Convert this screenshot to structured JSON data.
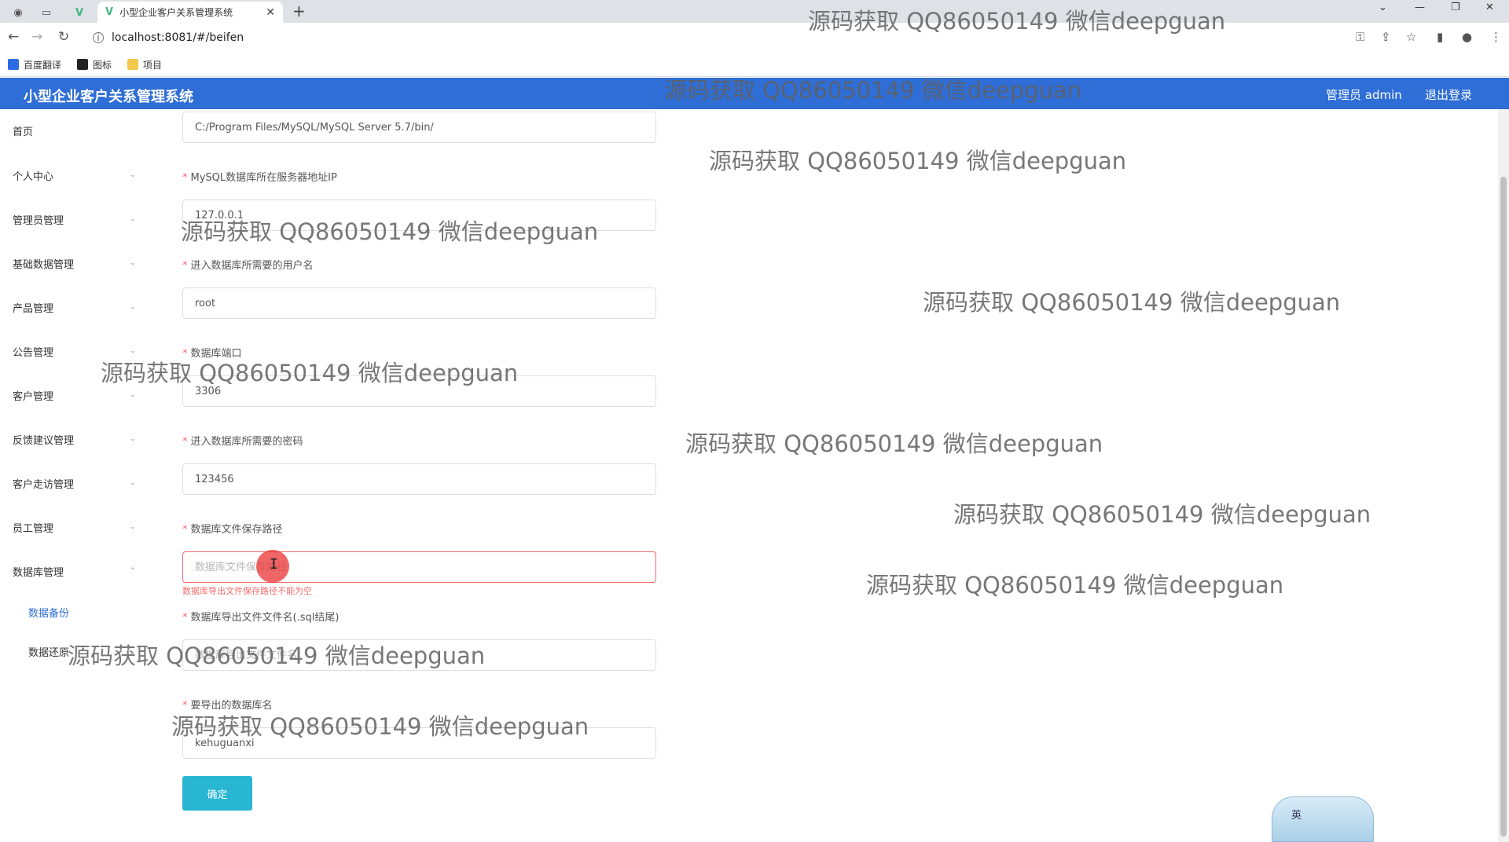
{
  "browser": {
    "tab_title": "小型企业客户关系管理系统",
    "tab_close": "✕",
    "new_tab": "+",
    "url": "localhost:8081/#/beifen",
    "bookmarks": [
      {
        "label": "百度翻译",
        "color": "#2d6be4"
      },
      {
        "label": "图标",
        "color": "#222222"
      },
      {
        "label": "项目",
        "color": "#f2c94c"
      }
    ]
  },
  "header": {
    "title": "小型企业客户关系管理系统",
    "user": "管理员 admin",
    "logout": "退出登录",
    "color": "#2f6ed6"
  },
  "sidebar": {
    "items": [
      {
        "label": "首页"
      },
      {
        "label": "个人中心"
      },
      {
        "label": "管理员管理"
      },
      {
        "label": "基础数据管理"
      },
      {
        "label": "产品管理"
      },
      {
        "label": "公告管理"
      },
      {
        "label": "客户管理"
      },
      {
        "label": "反馈建议管理"
      },
      {
        "label": "客户走访管理"
      },
      {
        "label": "员工管理"
      },
      {
        "label": "数据库管理"
      }
    ],
    "subitems": [
      {
        "label": "数据备份"
      },
      {
        "label": "数据还原"
      }
    ],
    "active_color": "#2f6ed6"
  },
  "form": {
    "mysql_path": {
      "value": "C:/Program Files/MySQL/MySQL Server 5.7/bin/"
    },
    "ip": {
      "label": "MySQL数据库所在服务器地址IP",
      "value": "127.0.0.1"
    },
    "username": {
      "label": "进入数据库所需要的用户名",
      "value": "root"
    },
    "port": {
      "label": "数据库端口",
      "value": "3306"
    },
    "password": {
      "label": "进入数据库所需要的密码",
      "value": "123456"
    },
    "save_path": {
      "label": "数据库文件保存路径",
      "placeholder": "数据库文件保存路径",
      "error": "数据库导出文件保存路径不能为空"
    },
    "filename": {
      "label": "数据库导出文件文件名(.sql结尾)",
      "placeholder": "数据库导出文件文件名"
    },
    "dbname": {
      "label": "要导出的数据库名",
      "value": "kehuguanxi"
    },
    "submit": "确定",
    "required_mark": "*"
  },
  "ime": {
    "label": "英"
  },
  "watermark": "源码获取 QQ86050149 微信deepguan"
}
